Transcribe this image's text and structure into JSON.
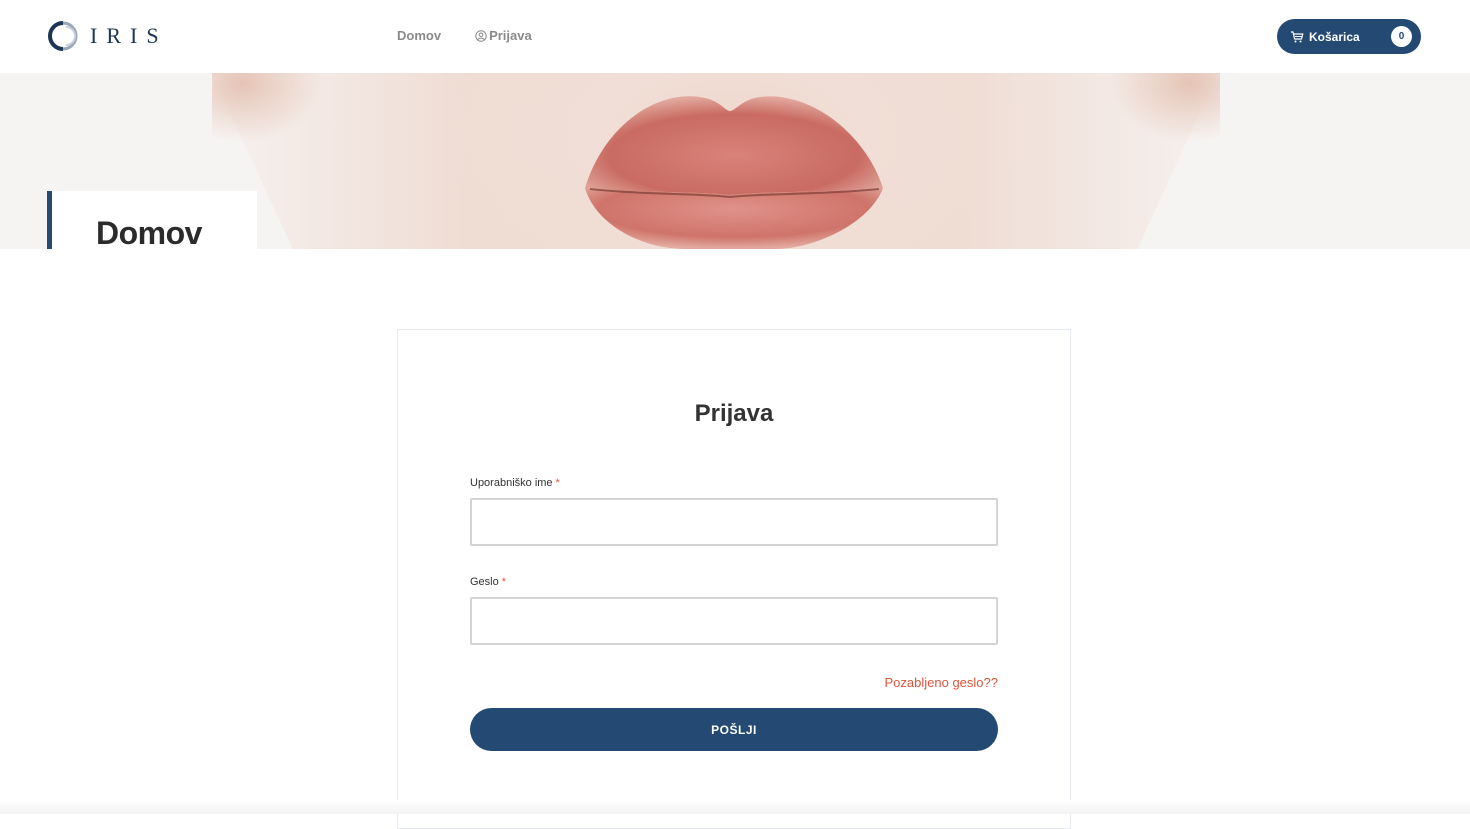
{
  "brand": {
    "logo_text": "IRIS",
    "primary_color": "#244a74",
    "accent_color": "#e0553b"
  },
  "nav": {
    "items": [
      {
        "label": "Domov",
        "icon": null
      },
      {
        "label": "Prijava",
        "icon": "user-circle-icon"
      }
    ]
  },
  "cart": {
    "label": "Košarica",
    "count": "0",
    "icon": "shopping-cart-icon"
  },
  "hero": {
    "title": "Domov"
  },
  "login": {
    "title": "Prijava",
    "username_label": "Uporabniško ime",
    "password_label": "Geslo",
    "required_mark": "*",
    "username_value": "",
    "password_value": "",
    "forgot_link": "Pozabljeno geslo??",
    "submit_label": "POŠLJI"
  }
}
